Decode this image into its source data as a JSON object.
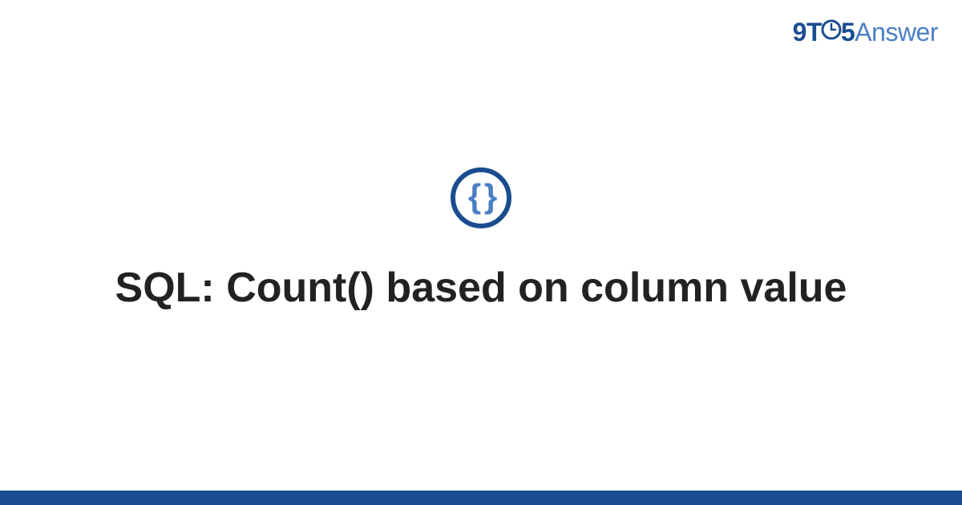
{
  "brand": {
    "part1": "9T",
    "part2": "5",
    "part3": "Answer"
  },
  "icon": {
    "braces": "{ }"
  },
  "title": "SQL: Count() based on column value",
  "colors": {
    "primary": "#1a4d8f",
    "secondary": "#4a7fc4",
    "text": "#222222"
  }
}
